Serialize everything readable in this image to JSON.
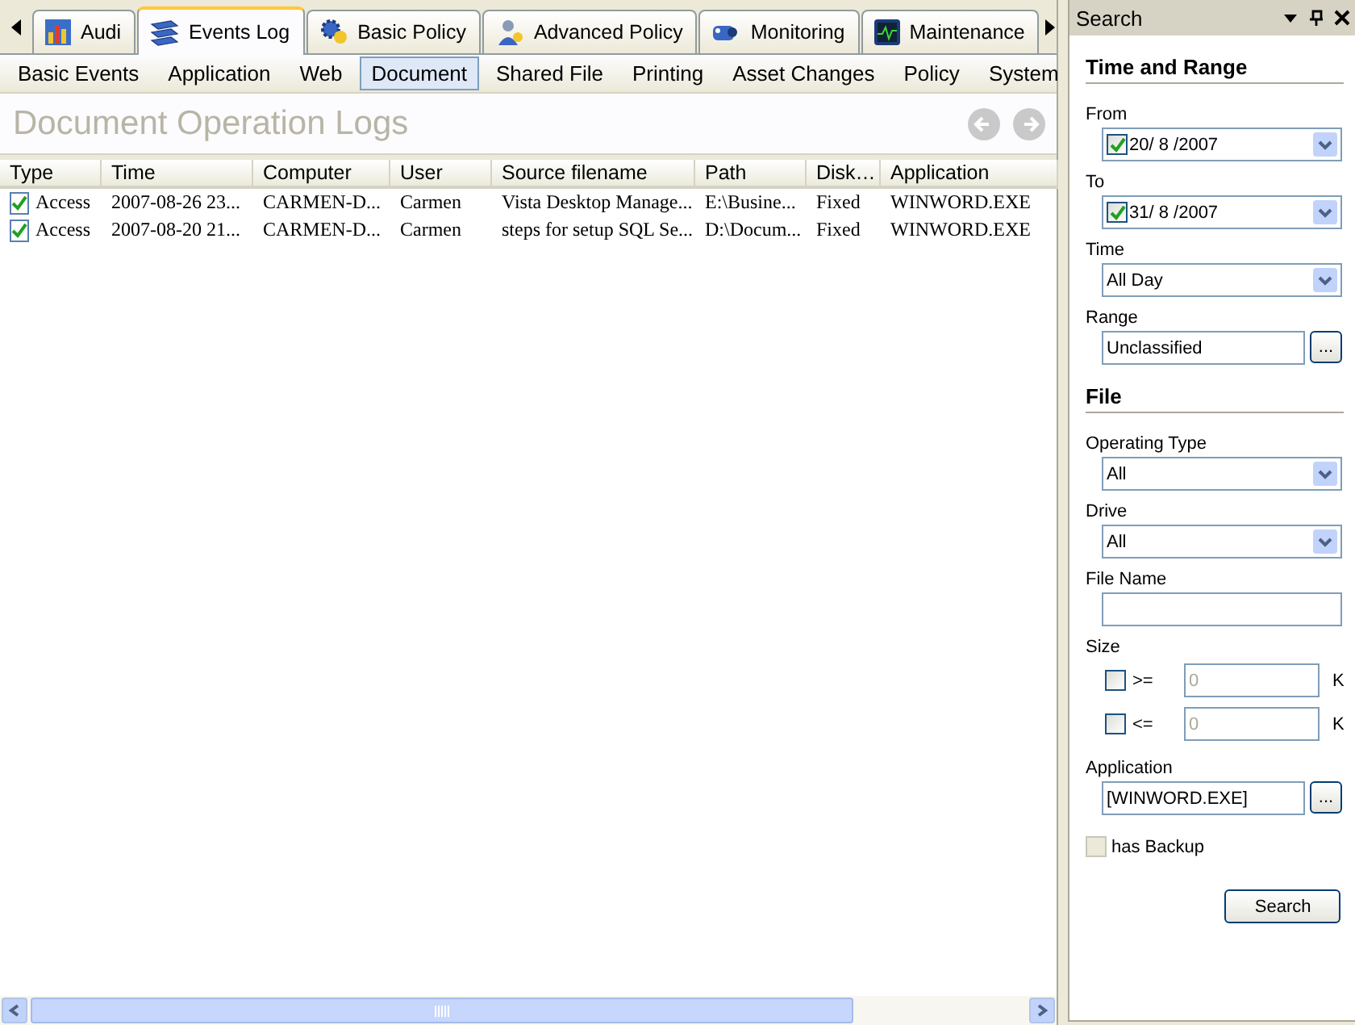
{
  "tabs": [
    {
      "label": "Audi",
      "selected": false
    },
    {
      "label": "Events Log",
      "selected": true
    },
    {
      "label": "Basic Policy",
      "selected": false
    },
    {
      "label": "Advanced Policy",
      "selected": false
    },
    {
      "label": "Monitoring",
      "selected": false
    },
    {
      "label": "Maintenance",
      "selected": false
    }
  ],
  "subtabs": [
    {
      "label": "Basic Events",
      "selected": false
    },
    {
      "label": "Application",
      "selected": false
    },
    {
      "label": "Web",
      "selected": false
    },
    {
      "label": "Document",
      "selected": true
    },
    {
      "label": "Shared File",
      "selected": false
    },
    {
      "label": "Printing",
      "selected": false
    },
    {
      "label": "Asset Changes",
      "selected": false
    },
    {
      "label": "Policy",
      "selected": false
    },
    {
      "label": "System",
      "selected": false
    }
  ],
  "page_title": "Document Operation Logs",
  "table": {
    "columns": [
      "Type",
      "Time",
      "Computer",
      "User",
      "Source filename",
      "Path",
      "Disk…",
      "Application"
    ],
    "rows": [
      [
        "Access",
        "2007-08-26 23...",
        "CARMEN-D...",
        "Carmen",
        "Vista Desktop Manage...",
        "E:\\Busine...",
        "Fixed",
        "WINWORD.EXE"
      ],
      [
        "Access",
        "2007-08-20 21...",
        "CARMEN-D...",
        "Carmen",
        "steps for setup SQL Se...",
        "D:\\Docum...",
        "Fixed",
        "WINWORD.EXE"
      ]
    ]
  },
  "search_panel": {
    "title": "Search",
    "sections": [
      {
        "title": "Time and Range",
        "fields": [
          {
            "kind": "date",
            "label": "From",
            "checked": true,
            "date": "20/ 8 /2007"
          },
          {
            "kind": "date",
            "label": "To",
            "checked": true,
            "date": "31/ 8 /2007"
          },
          {
            "kind": "select",
            "label": "Time",
            "value": "All Day"
          },
          {
            "kind": "browse",
            "label": "Range",
            "value": "Unclassified",
            "button": "..."
          }
        ]
      },
      {
        "title": "File",
        "fields": [
          {
            "kind": "select",
            "label": "Operating Type",
            "value": "All"
          },
          {
            "kind": "select",
            "label": "Drive",
            "value": "All"
          },
          {
            "kind": "text",
            "label": "File Name"
          },
          {
            "kind": "size",
            "label": "Size",
            "rows": [
              {
                "checked": false,
                "operator": ">=",
                "value": "0",
                "disabled": true,
                "unit": "K"
              },
              {
                "checked": false,
                "operator": "<=",
                "value": "0",
                "disabled": true,
                "unit": "K"
              }
            ]
          },
          {
            "kind": "browse",
            "label": "Application",
            "value": "[WINWORD.EXE]",
            "button": "..."
          },
          {
            "kind": "checkbox",
            "label": "has Backup",
            "checked": false,
            "disabled": true
          }
        ]
      }
    ],
    "button": "Search"
  }
}
